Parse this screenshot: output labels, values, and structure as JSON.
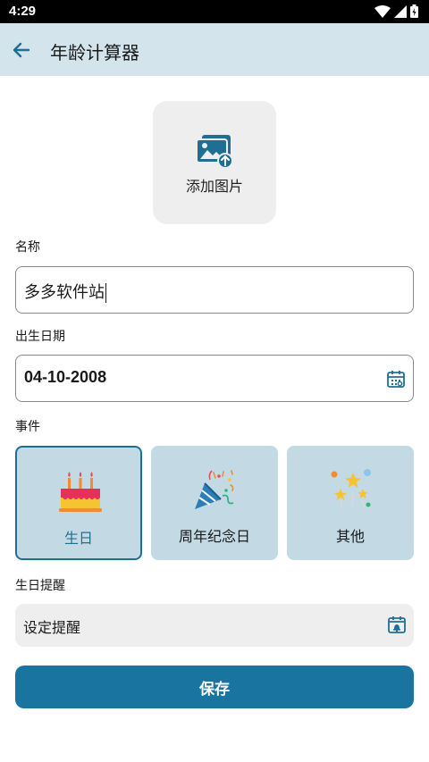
{
  "status_bar": {
    "time": "4:29",
    "icons": [
      "wifi-icon",
      "signal-icon",
      "battery-icon"
    ]
  },
  "app_bar": {
    "title": "年龄计算器",
    "back_icon": "arrow-left-icon"
  },
  "image_picker": {
    "label": "添加图片",
    "icon": "add-image-icon"
  },
  "name": {
    "label": "名称",
    "value": "多多软件站"
  },
  "birth_date": {
    "label": "出生日期",
    "value": "04-10-2008",
    "icon": "calendar-icon"
  },
  "event": {
    "label": "事件",
    "options": [
      {
        "label": "生日",
        "icon": "birthday-cake-icon",
        "selected": true
      },
      {
        "label": "周年纪念日",
        "icon": "party-popper-icon",
        "selected": false
      },
      {
        "label": "其他",
        "icon": "stars-icon",
        "selected": false
      }
    ]
  },
  "reminder": {
    "label": "生日提醒",
    "placeholder": "设定提醒",
    "icon": "calendar-bell-icon"
  },
  "save_button": {
    "label": "保存"
  },
  "colors": {
    "app_bar": "#d3e4ec",
    "accent": "#1a74a0",
    "card": "#c3d9e4",
    "selected_border": "#1f6f95"
  }
}
